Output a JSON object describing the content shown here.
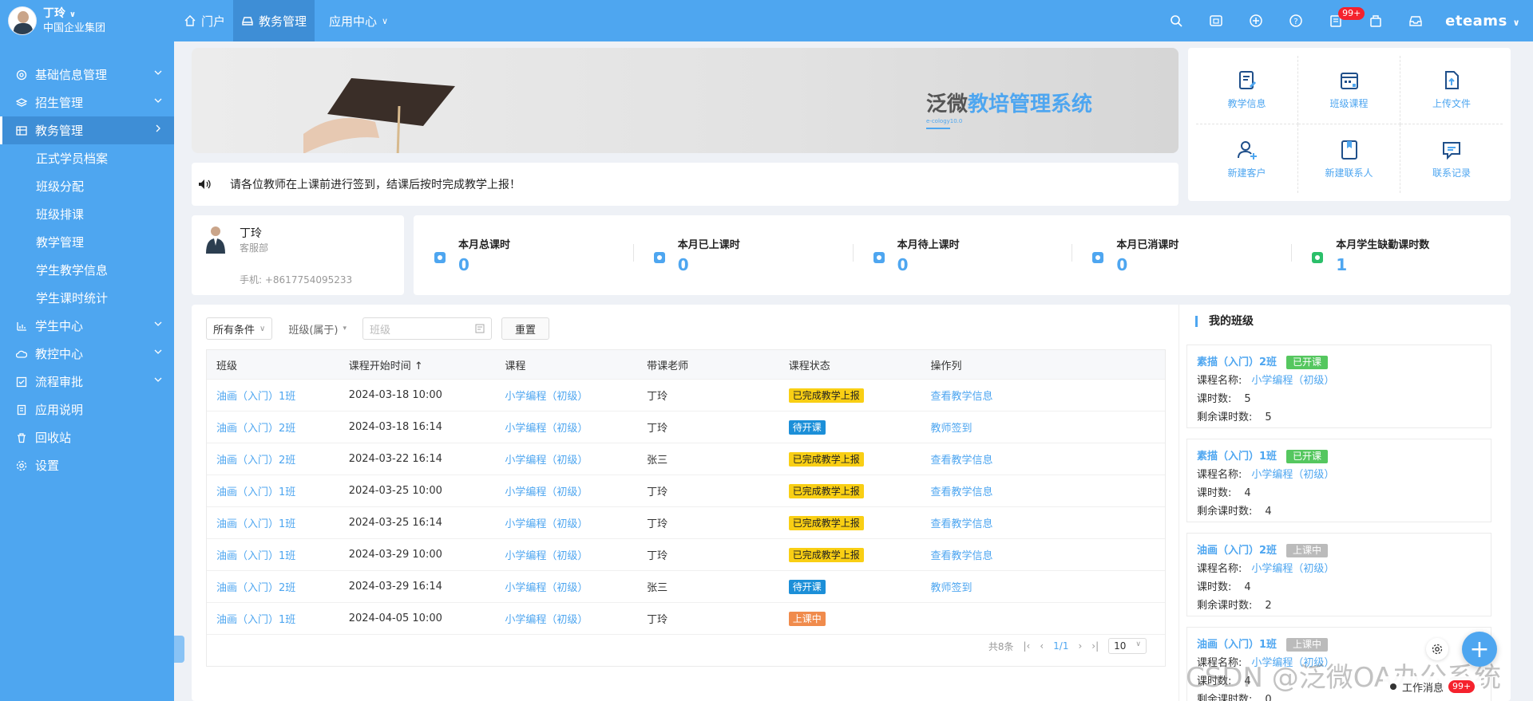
{
  "user": {
    "name": "丁玲",
    "company": "中国企业集团"
  },
  "nav": {
    "items": [
      {
        "label": "门户"
      },
      {
        "label": "教务管理"
      },
      {
        "label": "应用中心"
      }
    ]
  },
  "topbar": {
    "badge": "99+",
    "brand": "eteams"
  },
  "sidebar": {
    "items": [
      {
        "label": "基础信息管理"
      },
      {
        "label": "招生管理"
      },
      {
        "label": "教务管理"
      },
      {
        "label": "学生中心"
      },
      {
        "label": "教控中心"
      },
      {
        "label": "流程审批"
      },
      {
        "label": "应用说明"
      },
      {
        "label": "回收站"
      },
      {
        "label": "设置"
      }
    ],
    "subitems": [
      {
        "label": "正式学员档案"
      },
      {
        "label": "班级分配"
      },
      {
        "label": "班级排课"
      },
      {
        "label": "教学管理"
      },
      {
        "label": "学生教学信息"
      },
      {
        "label": "学生课时统计"
      }
    ]
  },
  "banner": {
    "title_prefix": "泛微",
    "title_highlight": "教培管理系统",
    "subtitle": "e-cology10.0"
  },
  "notice": {
    "text": "请各位教师在上课前进行签到，结课后按时完成教学上报！"
  },
  "quick": {
    "items": [
      {
        "label": "教学信息"
      },
      {
        "label": "班级课程"
      },
      {
        "label": "上传文件"
      },
      {
        "label": "新建客户"
      },
      {
        "label": "新建联系人"
      },
      {
        "label": "联系记录"
      }
    ]
  },
  "profile": {
    "name": "丁玲",
    "dept": "客服部",
    "phone": "手机: +8617754095233"
  },
  "stats": [
    {
      "label": "本月总课时",
      "value": "0"
    },
    {
      "label": "本月已上课时",
      "value": "0"
    },
    {
      "label": "本月待上课时",
      "value": "0"
    },
    {
      "label": "本月已消课时",
      "value": "0"
    },
    {
      "label": "本月学生缺勤课时数",
      "value": "1"
    }
  ],
  "filters": {
    "all_conditions": "所有条件",
    "class_filter": "班级(属于)",
    "class_placeholder": "班级",
    "reset": "重置"
  },
  "table": {
    "headers": [
      "班级",
      "课程开始时间 ↑",
      "课程",
      "带课老师",
      "课程状态",
      "操作列"
    ],
    "rows": [
      {
        "class": "油画（入门）1班",
        "time": "2024-03-18 10:00",
        "course": "小学编程（初级）",
        "teacher": "丁玲",
        "status": "已完成教学上报",
        "action": "查看教学信息"
      },
      {
        "class": "油画（入门）2班",
        "time": "2024-03-18 16:14",
        "course": "小学编程（初级）",
        "teacher": "丁玲",
        "status": "待开课",
        "action": "教师签到"
      },
      {
        "class": "油画（入门）2班",
        "time": "2024-03-22 16:14",
        "course": "小学编程（初级）",
        "teacher": "张三",
        "status": "已完成教学上报",
        "action": "查看教学信息"
      },
      {
        "class": "油画（入门）1班",
        "time": "2024-03-25 10:00",
        "course": "小学编程（初级）",
        "teacher": "丁玲",
        "status": "已完成教学上报",
        "action": "查看教学信息"
      },
      {
        "class": "油画（入门）1班",
        "time": "2024-03-25 16:14",
        "course": "小学编程（初级）",
        "teacher": "丁玲",
        "status": "已完成教学上报",
        "action": "查看教学信息"
      },
      {
        "class": "油画（入门）1班",
        "time": "2024-03-29 10:00",
        "course": "小学编程（初级）",
        "teacher": "丁玲",
        "status": "已完成教学上报",
        "action": "查看教学信息"
      },
      {
        "class": "油画（入门）2班",
        "time": "2024-03-29 16:14",
        "course": "小学编程（初级）",
        "teacher": "张三",
        "status": "待开课",
        "action": "教师签到"
      },
      {
        "class": "油画（入门）1班",
        "time": "2024-04-05 10:00",
        "course": "小学编程（初级）",
        "teacher": "丁玲",
        "status": "上课中",
        "action": ""
      }
    ]
  },
  "pagination": {
    "total": "共8条",
    "page": "1/1",
    "page_size": "10"
  },
  "my_classes": {
    "title": "我的班级",
    "course_label": "课程名称:",
    "hours_label": "课时数:",
    "remaining_label": "剩余课时数:",
    "cards": [
      {
        "name": "素描（入门）2班",
        "status": "已开课",
        "course": "小学编程（初级）",
        "hours": "5",
        "remaining": "5"
      },
      {
        "name": "素描（入门）1班",
        "status": "已开课",
        "course": "小学编程（初级）",
        "hours": "4",
        "remaining": "4"
      },
      {
        "name": "油画（入门）2班",
        "status": "上课中",
        "course": "小学编程（初级）",
        "hours": "4",
        "remaining": "2"
      },
      {
        "name": "油画（入门）1班",
        "status": "上课中",
        "course": "小学编程（初级）",
        "hours": "4",
        "remaining": "0"
      }
    ]
  },
  "float": {
    "fab": "+",
    "work_msg": "工作消息",
    "work_badge": "99+"
  },
  "watermark": "CSDN @泛微OA办公系统",
  "colors": {
    "accent": "#4ea6f0",
    "sidebar": "#4ea6f0",
    "status_done": "#f9cf14",
    "status_pending": "#1c8fd8",
    "status_active": "#f08b4c",
    "class_open": "#55c75f",
    "class_active": "#bbbbbb"
  },
  "icons": [
    "home-icon",
    "edu-icon",
    "search-icon",
    "calendar-icon",
    "plus-circle-icon",
    "help-icon",
    "message-icon",
    "bag-icon",
    "inbox-icon",
    "speaker-icon"
  ]
}
